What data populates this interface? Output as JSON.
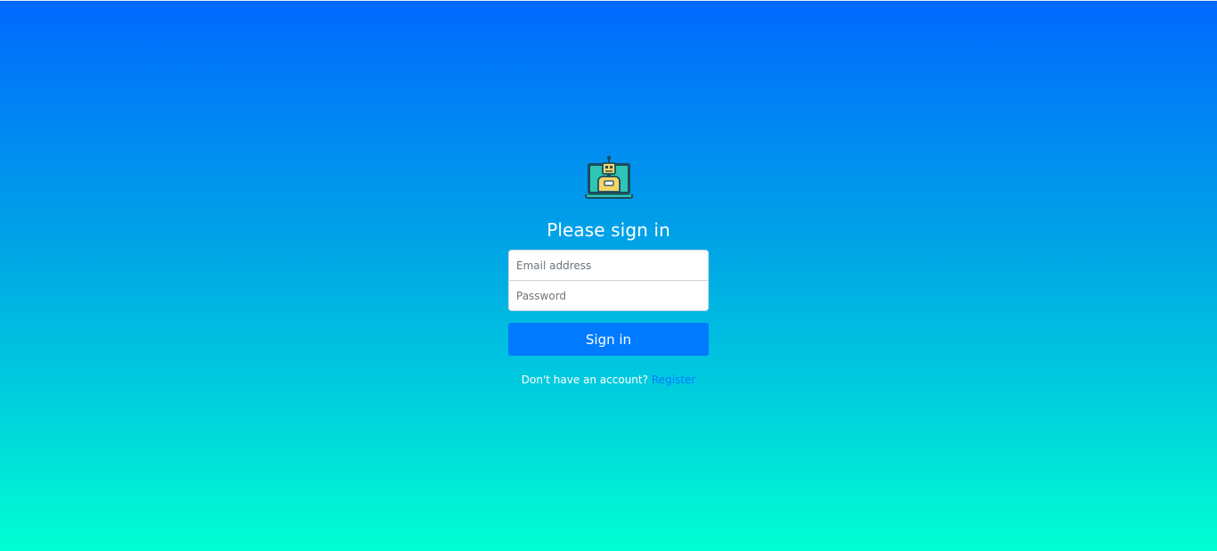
{
  "login": {
    "title": "Please sign in",
    "email_placeholder": "Email address",
    "email_value": "",
    "password_placeholder": "Password",
    "password_value": "",
    "submit_label": "Sign in",
    "register_prompt": "Don't have an account?",
    "register_link": "Register",
    "logo_icon": "robot-laptop-icon"
  },
  "colors": {
    "gradient_top": "#0069ff",
    "gradient_bottom": "#00ffd2",
    "primary": "#007bff",
    "text_on_background": "#ffffff"
  }
}
